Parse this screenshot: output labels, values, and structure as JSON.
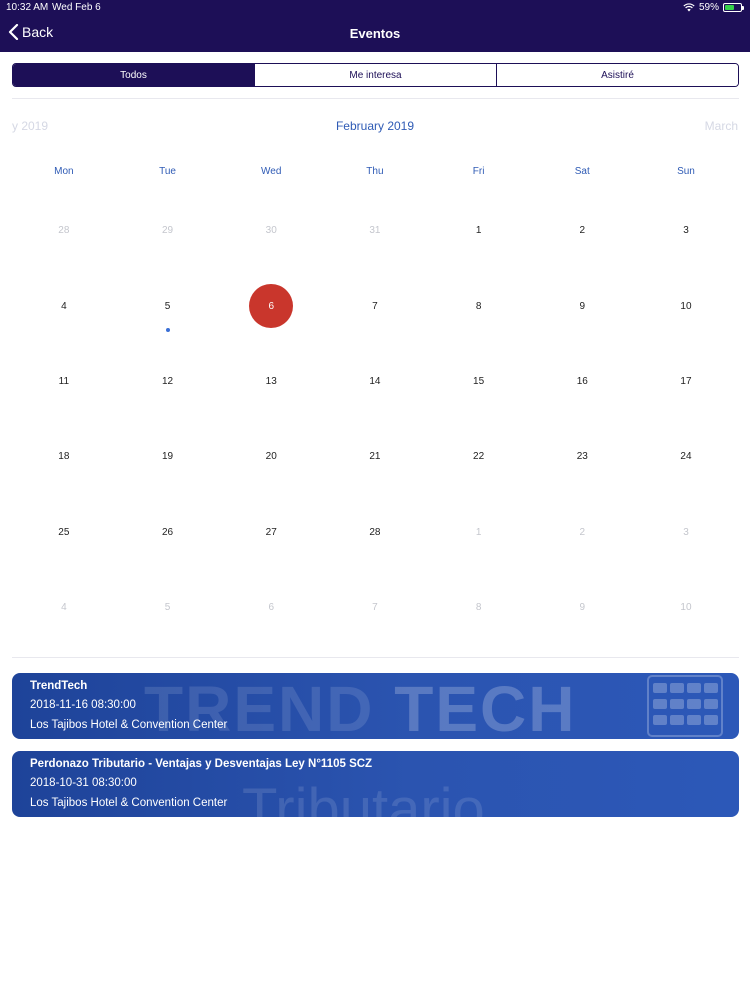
{
  "status": {
    "time": "10:32 AM",
    "date": "Wed Feb 6",
    "battery": "59%",
    "battery_level": 0.59
  },
  "nav": {
    "back_label": "Back",
    "title": "Eventos"
  },
  "segments": [
    {
      "label": "Todos",
      "active": true
    },
    {
      "label": "Me interesa",
      "active": false
    },
    {
      "label": "Asistiré",
      "active": false
    }
  ],
  "calendar": {
    "prev_month": "y 2019",
    "current_month": "February 2019",
    "next_month": "March",
    "weekdays": [
      "Mon",
      "Tue",
      "Wed",
      "Thu",
      "Fri",
      "Sat",
      "Sun"
    ],
    "weeks": [
      [
        {
          "d": "28",
          "m": true
        },
        {
          "d": "29",
          "m": true
        },
        {
          "d": "30",
          "m": true
        },
        {
          "d": "31",
          "m": true
        },
        {
          "d": "1"
        },
        {
          "d": "2"
        },
        {
          "d": "3"
        }
      ],
      [
        {
          "d": "4"
        },
        {
          "d": "5",
          "dot": true
        },
        {
          "d": "6",
          "today": true
        },
        {
          "d": "7"
        },
        {
          "d": "8"
        },
        {
          "d": "9"
        },
        {
          "d": "10"
        }
      ],
      [
        {
          "d": "11"
        },
        {
          "d": "12"
        },
        {
          "d": "13"
        },
        {
          "d": "14"
        },
        {
          "d": "15"
        },
        {
          "d": "16"
        },
        {
          "d": "17"
        }
      ],
      [
        {
          "d": "18"
        },
        {
          "d": "19"
        },
        {
          "d": "20"
        },
        {
          "d": "21"
        },
        {
          "d": "22"
        },
        {
          "d": "23"
        },
        {
          "d": "24"
        }
      ],
      [
        {
          "d": "25"
        },
        {
          "d": "26"
        },
        {
          "d": "27"
        },
        {
          "d": "28"
        },
        {
          "d": "1",
          "m": true
        },
        {
          "d": "2",
          "m": true
        },
        {
          "d": "3",
          "m": true
        }
      ],
      [
        {
          "d": "4",
          "m": true
        },
        {
          "d": "5",
          "m": true
        },
        {
          "d": "6",
          "m": true
        },
        {
          "d": "7",
          "m": true
        },
        {
          "d": "8",
          "m": true
        },
        {
          "d": "9",
          "m": true
        },
        {
          "d": "10",
          "m": true
        }
      ]
    ]
  },
  "events": [
    {
      "name": "TrendTech",
      "datetime": "2018-11-16 08:30:00",
      "place": "Los Tajibos Hotel & Convention Center",
      "banner_a": "TREND",
      "banner_b": "TECH"
    },
    {
      "name": "Perdonazo Tributario - Ventajas y Desventajas Ley N°1105 SCZ",
      "datetime": "2018-10-31 08:30:00",
      "place": "Los Tajibos Hotel & Convention Center",
      "banner_a": "Tributario"
    }
  ],
  "colors": {
    "header": "#1d0f57",
    "accent": "#2f5bb5",
    "today": "#c9362c",
    "event_card": "#2b54b0"
  }
}
